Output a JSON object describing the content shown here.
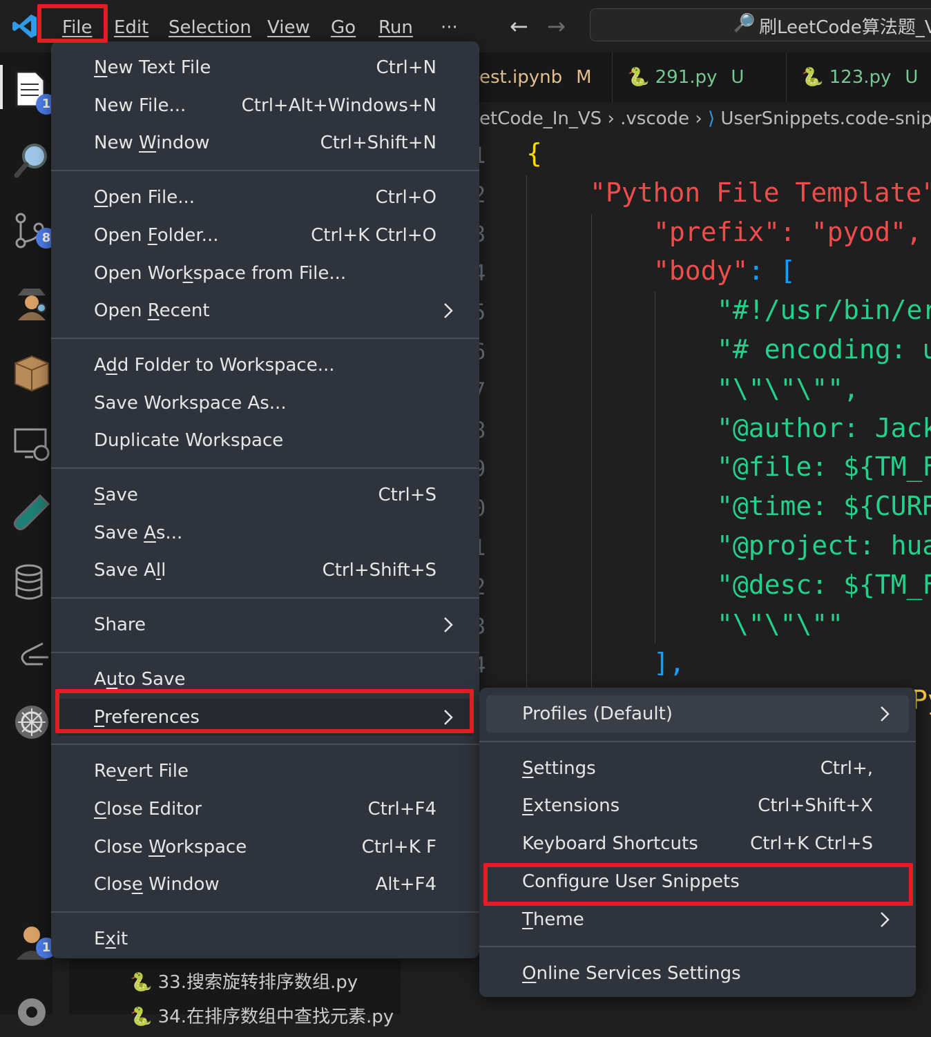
{
  "menubar": {
    "items": [
      {
        "label": "File",
        "mnemonic": "F"
      },
      {
        "label": "Edit",
        "mnemonic": "E"
      },
      {
        "label": "Selection",
        "mnemonic": "S"
      },
      {
        "label": "View",
        "mnemonic": "V"
      },
      {
        "label": "Go",
        "mnemonic": "G"
      },
      {
        "label": "Run",
        "mnemonic": "R"
      }
    ],
    "more": "···",
    "back_icon": "arrow-left-icon",
    "forward_icon": "arrow-right-icon"
  },
  "search": {
    "text": "刷LeetCode算法题_VS"
  },
  "activity": {
    "explorer_badge": "1",
    "scm_badge": "8",
    "accounts_badge": "1"
  },
  "tabs": [
    {
      "label": "est.ipynb",
      "status": "M",
      "color": "#e2c08d"
    },
    {
      "label": "291.py",
      "status": "U",
      "color": "#73c991"
    },
    {
      "label": "123.py",
      "status": "U",
      "color": "#73c991"
    }
  ],
  "breadcrumb": {
    "part1": "etCode_In_VS",
    "part2": ".vscode",
    "part3": "UserSnippets.code-snipp"
  },
  "editor": {
    "line_numbers": [
      "1",
      "2",
      "3",
      "4",
      "5",
      "6",
      "7",
      "8",
      "9",
      "0",
      "1",
      "2",
      "3",
      "4"
    ],
    "lines": [
      {
        "text": "{",
        "indent": 0,
        "color": "#ffd700"
      },
      {
        "text": "\"Python File Template\"",
        "indent": 1,
        "color": "#f14c4c"
      },
      {
        "text": "\"prefix\"",
        "indent": 2,
        "color": "#f14c4c",
        "rest": ": \"pyod\",",
        "rest_color": "#f14c4c"
      },
      {
        "text": "\"body\"",
        "indent": 2,
        "color": "#f14c4c",
        "rest": ": [",
        "rest_color": "#179fff"
      },
      {
        "text": "\"#!/usr/bin/er",
        "indent": 3,
        "color": "#23d18b"
      },
      {
        "text": "\"# encoding: u",
        "indent": 3,
        "color": "#23d18b"
      },
      {
        "text": "\"\\\"\\\"\\\"\",",
        "indent": 3,
        "color": "#23d18b"
      },
      {
        "text": "\"@author: Jack",
        "indent": 3,
        "color": "#23d18b"
      },
      {
        "text": "\"@file: ${TM_F",
        "indent": 3,
        "color": "#23d18b"
      },
      {
        "text": "\"@time: ${CURR",
        "indent": 3,
        "color": "#23d18b"
      },
      {
        "text": "\"@project: hua",
        "indent": 3,
        "color": "#23d18b"
      },
      {
        "text": "\"@desc: ${TM_F",
        "indent": 3,
        "color": "#23d18b"
      },
      {
        "text": "\"\\\"\\\"\\\"\"",
        "indent": 3,
        "color": "#23d18b"
      },
      {
        "text": "],",
        "indent": 2,
        "color": "#179fff"
      }
    ],
    "partial_right": "Py"
  },
  "explorer": {
    "file1": "33.搜索旋转排序数组.py",
    "file2": "34.在排序数组中查找元素.py"
  },
  "file_menu": {
    "groups": [
      [
        {
          "label": "New Text File",
          "mn": "N",
          "kb": "Ctrl+N"
        },
        {
          "label": "New File...",
          "mn": "",
          "kb": "Ctrl+Alt+Windows+N"
        },
        {
          "label": "New Window",
          "mn": "W",
          "kb": "Ctrl+Shift+N"
        }
      ],
      [
        {
          "label": "Open File...",
          "mn": "O",
          "kb": "Ctrl+O"
        },
        {
          "label": "Open Folder...",
          "mn": "F",
          "kb": "Ctrl+K Ctrl+O"
        },
        {
          "label": "Open Workspace from File...",
          "mn": "k",
          "kb": ""
        },
        {
          "label": "Open Recent",
          "mn": "R",
          "kb": "",
          "submenu": true
        }
      ],
      [
        {
          "label": "Add Folder to Workspace...",
          "mn": "d",
          "kb": ""
        },
        {
          "label": "Save Workspace As...",
          "mn": "",
          "kb": ""
        },
        {
          "label": "Duplicate Workspace",
          "mn": "",
          "kb": ""
        }
      ],
      [
        {
          "label": "Save",
          "mn": "S",
          "kb": "Ctrl+S"
        },
        {
          "label": "Save As...",
          "mn": "A",
          "kb": ""
        },
        {
          "label": "Save All",
          "mn": "l",
          "kb": "Ctrl+Shift+S"
        }
      ],
      [
        {
          "label": "Share",
          "mn": "",
          "kb": "",
          "submenu": true
        }
      ],
      [
        {
          "label": "Auto Save",
          "mn": "u",
          "kb": ""
        },
        {
          "label": "Preferences",
          "mn": "P",
          "kb": "",
          "submenu": true,
          "active": true
        }
      ],
      [
        {
          "label": "Revert File",
          "mn": "v",
          "kb": ""
        },
        {
          "label": "Close Editor",
          "mn": "C",
          "kb": "Ctrl+F4"
        },
        {
          "label": "Close Workspace",
          "mn": "W",
          "kb": "Ctrl+K F"
        },
        {
          "label": "Close Window",
          "mn": "e",
          "kb": "Alt+F4"
        }
      ],
      [
        {
          "label": "Exit",
          "mn": "x",
          "kb": ""
        }
      ]
    ]
  },
  "prefs_menu": {
    "groups": [
      [
        {
          "label": "Profiles (Default)",
          "mn": "",
          "kb": "",
          "submenu": true
        }
      ],
      [
        {
          "label": "Settings",
          "mn": "S",
          "kb": "Ctrl+,"
        },
        {
          "label": "Extensions",
          "mn": "E",
          "kb": "Ctrl+Shift+X"
        },
        {
          "label": "Keyboard Shortcuts",
          "mn": "",
          "kb": "Ctrl+K Ctrl+S"
        },
        {
          "label": "Configure User Snippets",
          "mn": "",
          "kb": "",
          "highlight": true
        },
        {
          "label": "Theme",
          "mn": "T",
          "kb": "",
          "submenu": true
        }
      ],
      [
        {
          "label": "Online Services Settings",
          "mn": "O",
          "kb": ""
        }
      ]
    ]
  },
  "colors": {
    "highlight_box": "#e41c23",
    "menu_bg": "#2f333b",
    "accent_badge": "#4d7de8"
  }
}
